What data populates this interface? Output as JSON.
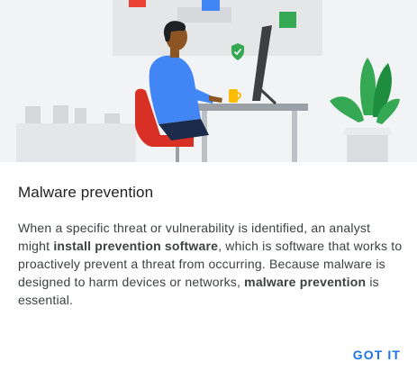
{
  "dialog": {
    "title": "Malware prevention",
    "body": {
      "part1": "When a specific threat or vulnerability is identified, an analyst might ",
      "bold1": "install prevention software",
      "part2": ", which is software that works to proactively prevent a threat from occurring. Because malware is designed to harm devices or networks, ",
      "bold2": "malware prevention",
      "part3": " is essential."
    },
    "got_it_label": "GOT IT"
  },
  "colors": {
    "accent": "#1a73e8",
    "hero_background": "#f1f3f4",
    "shield": "#34a853",
    "chair": "#d93025",
    "shirt": "#4285f4",
    "mug": "#fbbc04"
  },
  "illustration": {
    "icons": [
      "shield-check-icon",
      "sticky-note-red",
      "sticky-note-blue",
      "sticky-note-green"
    ]
  }
}
